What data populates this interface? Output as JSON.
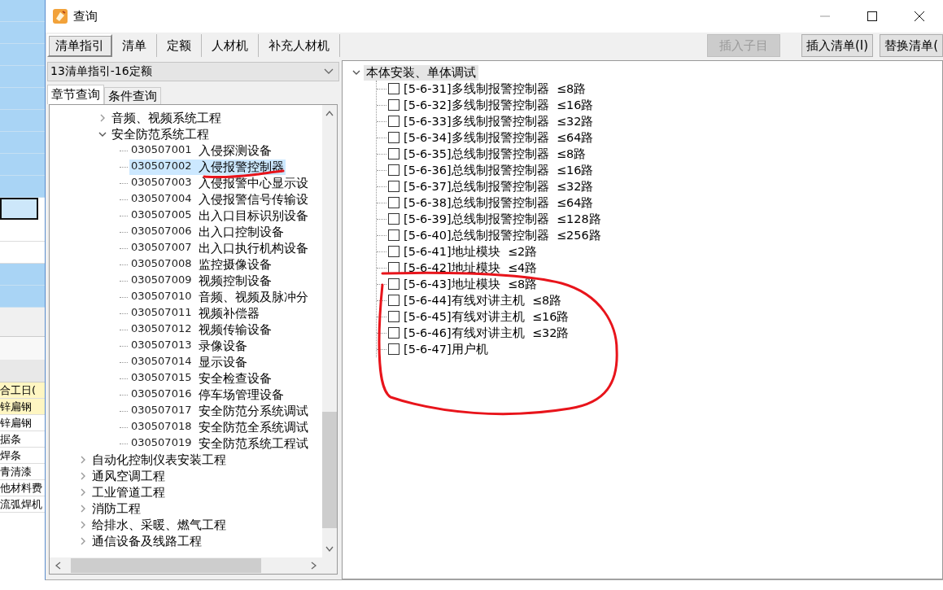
{
  "background_sheet": {
    "rows": [
      {
        "text": "合工日(",
        "highlighted": true
      },
      {
        "text": "锌扁钢",
        "highlighted": true
      },
      {
        "text": "锌扁钢",
        "highlighted": false
      },
      {
        "text": "据条",
        "highlighted": false
      },
      {
        "text": "焊条",
        "highlighted": false
      },
      {
        "text": "青清漆",
        "highlighted": false
      },
      {
        "text": "他材料费",
        "highlighted": false
      },
      {
        "text": "流弧焊机",
        "highlighted": false
      }
    ]
  },
  "window": {
    "title": "查询"
  },
  "tabs": [
    {
      "label": "清单指引",
      "selected": true
    },
    {
      "label": "清单",
      "selected": false
    },
    {
      "label": "定额",
      "selected": false
    },
    {
      "label": "人材机",
      "selected": false
    },
    {
      "label": "补充人材机",
      "selected": false
    }
  ],
  "toolbar_buttons": [
    {
      "label": "插入子目",
      "disabled": true
    },
    {
      "label": "插入清单(I)",
      "disabled": false
    },
    {
      "label": "替换清单(",
      "disabled": false
    }
  ],
  "library_select": {
    "value": "13清单指引-16定额"
  },
  "query_tabs": [
    {
      "label": "章节查询",
      "selected": true
    },
    {
      "label": "条件查询",
      "selected": false
    }
  ],
  "chapter_tree": {
    "scrolled_branch": [
      {
        "label": "音频、视频系统工程",
        "expanded": false
      },
      {
        "label": "安全防范系统工程",
        "expanded": true,
        "children": [
          {
            "code": "030507001",
            "name": "入侵探测设备",
            "selected": false
          },
          {
            "code": "030507002",
            "name": "入侵报警控制器",
            "selected": true
          },
          {
            "code": "030507003",
            "name": "入侵报警中心显示设",
            "selected": false
          },
          {
            "code": "030507004",
            "name": "入侵报警信号传输设",
            "selected": false
          },
          {
            "code": "030507005",
            "name": "出入口目标识别设备",
            "selected": false
          },
          {
            "code": "030507006",
            "name": "出入口控制设备",
            "selected": false
          },
          {
            "code": "030507007",
            "name": "出入口执行机构设备",
            "selected": false
          },
          {
            "code": "030507008",
            "name": "监控摄像设备",
            "selected": false
          },
          {
            "code": "030507009",
            "name": "视频控制设备",
            "selected": false
          },
          {
            "code": "030507010",
            "name": "音频、视频及脉冲分",
            "selected": false
          },
          {
            "code": "030507011",
            "name": "视频补偿器",
            "selected": false
          },
          {
            "code": "030507012",
            "name": "视频传输设备",
            "selected": false
          },
          {
            "code": "030507013",
            "name": "录像设备",
            "selected": false
          },
          {
            "code": "030507014",
            "name": "显示设备",
            "selected": false
          },
          {
            "code": "030507015",
            "name": "安全检查设备",
            "selected": false
          },
          {
            "code": "030507016",
            "name": "停车场管理设备",
            "selected": false
          },
          {
            "code": "030507017",
            "name": "安全防范分系统调试",
            "selected": false
          },
          {
            "code": "030507018",
            "name": "安全防范全系统调试",
            "selected": false
          },
          {
            "code": "030507019",
            "name": "安全防范系统工程试",
            "selected": false
          }
        ]
      }
    ],
    "items": [
      {
        "label": "自动化控制仪表安装工程",
        "expanded": false
      },
      {
        "label": "通风空调工程",
        "expanded": false
      },
      {
        "label": "工业管道工程",
        "expanded": false
      },
      {
        "label": "消防工程",
        "expanded": false
      },
      {
        "label": "给排水、采暖、燃气工程",
        "expanded": false
      },
      {
        "label": "通信设备及线路工程",
        "expanded": false
      }
    ]
  },
  "quota_tree": {
    "label": "本体安装、单体调试",
    "expanded": true,
    "selected": true,
    "children": [
      {
        "label": "[5-6-31]多线制报警控制器  ≤8路",
        "checked": false
      },
      {
        "label": "[5-6-32]多线制报警控制器  ≤16路",
        "checked": false
      },
      {
        "label": "[5-6-33]多线制报警控制器  ≤32路",
        "checked": false
      },
      {
        "label": "[5-6-34]多线制报警控制器  ≤64路",
        "checked": false
      },
      {
        "label": "[5-6-35]总线制报警控制器  ≤8路",
        "checked": false
      },
      {
        "label": "[5-6-36]总线制报警控制器  ≤16路",
        "checked": false
      },
      {
        "label": "[5-6-37]总线制报警控制器  ≤32路",
        "checked": false
      },
      {
        "label": "[5-6-38]总线制报警控制器  ≤64路",
        "checked": false
      },
      {
        "label": "[5-6-39]总线制报警控制器  ≤128路",
        "checked": false
      },
      {
        "label": "[5-6-40]总线制报警控制器  ≤256路",
        "checked": false
      },
      {
        "label": "[5-6-41]地址模块  ≤2路",
        "checked": false
      },
      {
        "label": "[5-6-42]地址模块  ≤4路",
        "checked": false
      },
      {
        "label": "[5-6-43]地址模块  ≤8路",
        "checked": false
      },
      {
        "label": "[5-6-44]有线对讲主机  ≤8路",
        "checked": false
      },
      {
        "label": "[5-6-45]有线对讲主机  ≤16路",
        "checked": false
      },
      {
        "label": "[5-6-46]有线对讲主机  ≤32路",
        "checked": false
      },
      {
        "label": "[5-6-47]用户机",
        "checked": false
      }
    ]
  },
  "annotations": {
    "underline": true,
    "circle": true
  }
}
